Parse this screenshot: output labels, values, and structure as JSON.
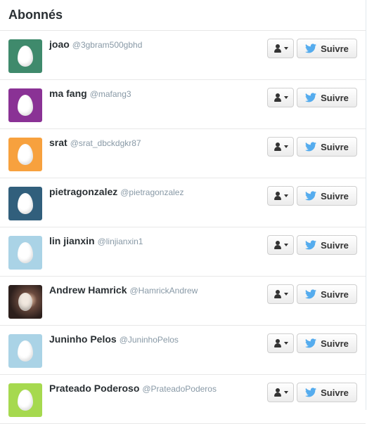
{
  "header": {
    "title": "Abonnés"
  },
  "follow_label": "Suivre",
  "accent_color": "#55acee",
  "followers": [
    {
      "name": "joao",
      "handle": "@3gbram500gbhd",
      "avatar_color": "#3f8a6c",
      "avatar_type": "egg"
    },
    {
      "name": "ma fang",
      "handle": "@mafang3",
      "avatar_color": "#8a3295",
      "avatar_type": "egg"
    },
    {
      "name": "srat",
      "handle": "@srat_dbckdgkr87",
      "avatar_color": "#f7a13e",
      "avatar_type": "egg"
    },
    {
      "name": "pietragonzalez",
      "handle": "@pietragonzalez",
      "avatar_color": "#315f7c",
      "avatar_type": "egg"
    },
    {
      "name": "lin jianxin",
      "handle": "@linjianxin1",
      "avatar_color": "#aad3e6",
      "avatar_type": "egg"
    },
    {
      "name": "Andrew Hamrick",
      "handle": "@HamrickAndrew",
      "avatar_color": "#3b2a25",
      "avatar_type": "photo"
    },
    {
      "name": "Juninho Pelos",
      "handle": "@JuninhoPelos",
      "avatar_color": "#aad3e6",
      "avatar_type": "egg"
    },
    {
      "name": "Prateado Poderoso",
      "handle": "@PrateadoPoderos",
      "avatar_color": "#a6d94f",
      "avatar_type": "egg"
    }
  ]
}
